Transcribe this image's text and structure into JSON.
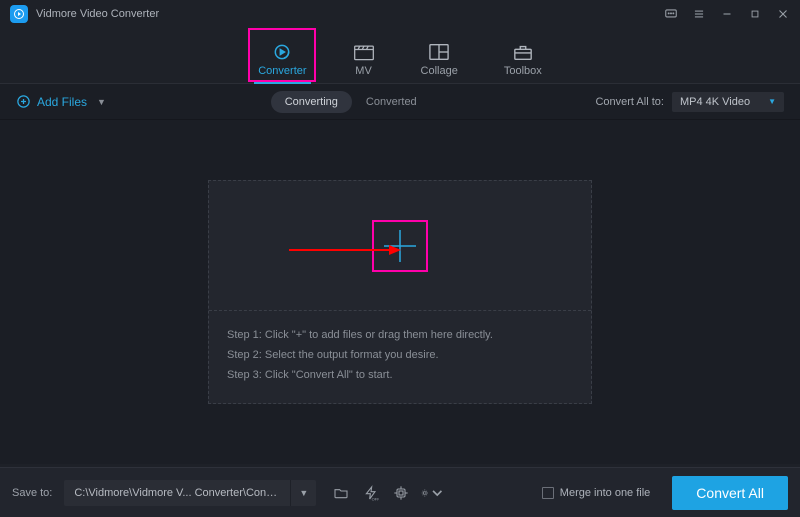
{
  "app": {
    "title": "Vidmore Video Converter"
  },
  "tabs": {
    "converter": "Converter",
    "mv": "MV",
    "collage": "Collage",
    "toolbox": "Toolbox"
  },
  "toolbar": {
    "add_files": "Add Files",
    "subtabs": {
      "converting": "Converting",
      "converted": "Converted"
    },
    "convert_all_to_label": "Convert All to:",
    "format": "MP4 4K Video"
  },
  "drop": {
    "step1": "Step 1: Click \"+\" to add files or drag them here directly.",
    "step2": "Step 2: Select the output format you desire.",
    "step3": "Step 3: Click \"Convert All\" to start."
  },
  "bottom": {
    "save_to_label": "Save to:",
    "path": "C:\\Vidmore\\Vidmore V... Converter\\Converted",
    "merge_label": "Merge into one file",
    "convert_all": "Convert All"
  }
}
